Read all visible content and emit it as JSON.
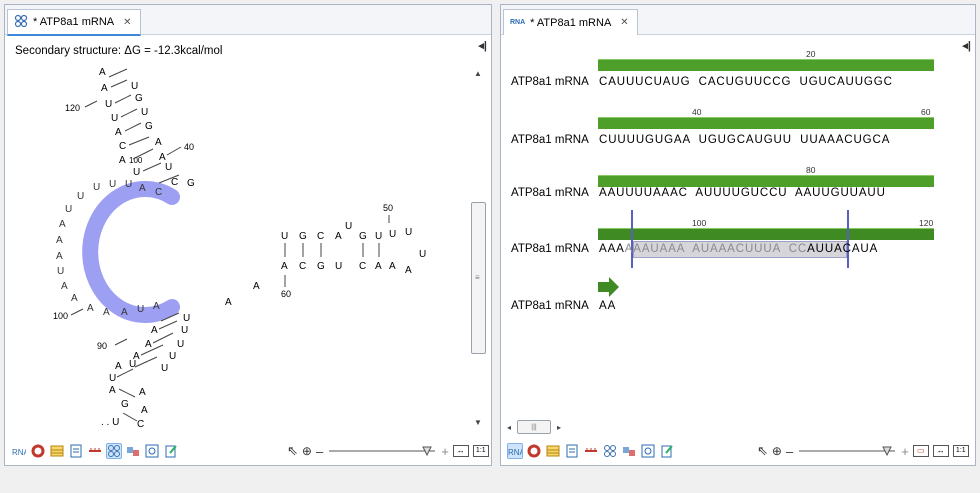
{
  "left_tab": {
    "label": "* ATP8a1 mRNA",
    "close": "✕"
  },
  "right_tab": {
    "label": "* ATP8a1 mRNA",
    "close": "✕"
  },
  "secondary_structure": {
    "title": "Secondary structure: ΔG = -12.3kcal/mol",
    "position_labels": [
      "120",
      "40",
      "50",
      "60",
      "90",
      "100"
    ],
    "highlight_color": "#8c8ff0"
  },
  "sequence_view": {
    "row_label": "ATP8a1 mRNA",
    "rows": [
      {
        "seq": "CAUUUCUAUG  CACUGUUCCG  UGUCAUUGGC",
        "ruler": [
          "20"
        ]
      },
      {
        "seq": "CUUUUGUGAA  UGUGCAUGUU  UUAAACUGCA",
        "ruler": [
          "40",
          "60"
        ]
      },
      {
        "seq": "AAUUUUAAAC  AUUUUGUCCU  AAUUGUUAUU",
        "ruler": [
          "80"
        ]
      },
      {
        "seq_pre": "AAA",
        "seq_sel": "AAAUAAA  AUAAACUUUA  CC",
        "seq_post": "AUUACAUA",
        "ruler": [
          "100",
          "120"
        ]
      },
      {
        "seq": "AA",
        "ruler": []
      }
    ],
    "bar_color": "#4d9f2a"
  },
  "icons": {
    "toolbar": [
      "rna-icon",
      "circle-icon",
      "table-icon",
      "lines-icon",
      "ruler-icon",
      "structure-icon",
      "linked-icon",
      "info-icon",
      "edit-icon"
    ],
    "zoom": [
      "pointer-icon",
      "zoom-in-icon",
      "zoom-out-icon",
      "zoom-plus-icon",
      "fit-width-icon",
      "one-to-one-icon"
    ]
  },
  "zoom": {
    "fit_label": "1:1"
  }
}
